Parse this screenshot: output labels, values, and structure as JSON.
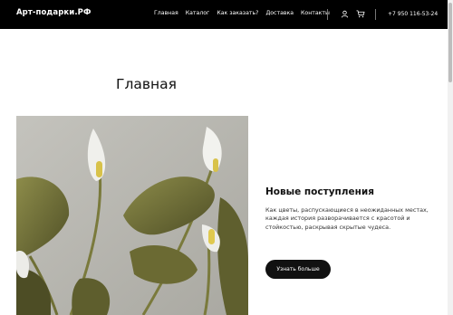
{
  "header": {
    "logo": "Арт-подарки.РФ",
    "nav": [
      {
        "label": "Главная"
      },
      {
        "label": "Каталог"
      },
      {
        "label": "Как заказать?"
      },
      {
        "label": "Доставка"
      },
      {
        "label": "Контакты"
      }
    ],
    "phone": "+7 950 116-53-24",
    "icons": [
      "user-icon",
      "cart-icon"
    ]
  },
  "main": {
    "title": "Главная",
    "hero": {
      "heading": "Новые поступления",
      "description": "Как цветы, распускающиеся в неожиданных местах, каждая история разворачивается с красотой и стойкостью, раскрывая скрытые чудеса.",
      "button_label": "Узнать больше"
    }
  },
  "colors": {
    "header_bg": "#000000",
    "button_bg": "#111111",
    "page_bg": "#ffffff"
  }
}
